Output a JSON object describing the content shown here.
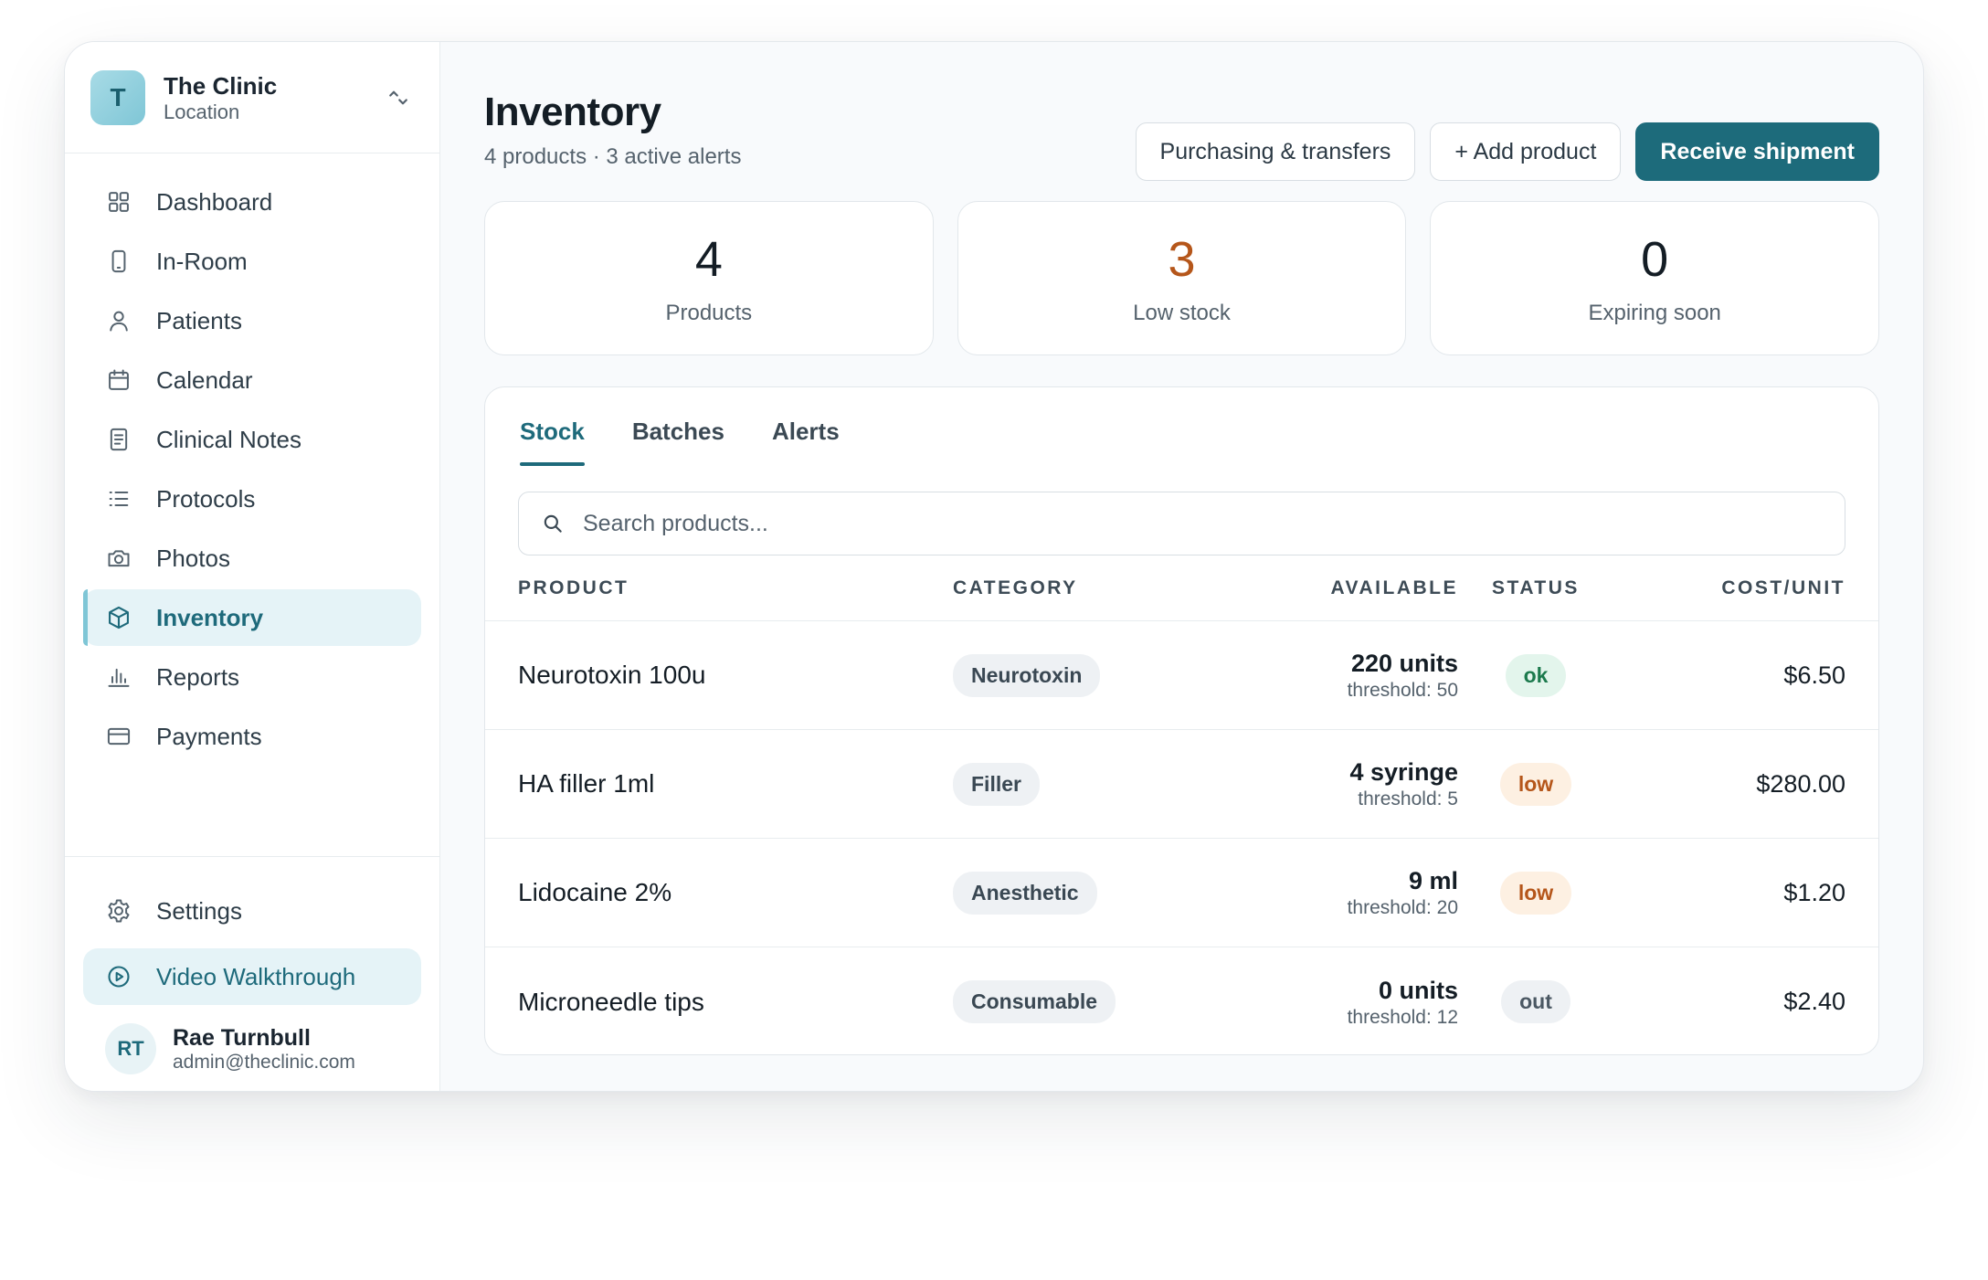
{
  "clinic": {
    "initial": "T",
    "name": "The Clinic",
    "subtitle": "Location"
  },
  "nav": {
    "items": [
      {
        "label": "Dashboard",
        "icon": "grid-icon"
      },
      {
        "label": "In-Room",
        "icon": "phone-icon"
      },
      {
        "label": "Patients",
        "icon": "user-icon"
      },
      {
        "label": "Calendar",
        "icon": "calendar-icon"
      },
      {
        "label": "Clinical Notes",
        "icon": "document-icon"
      },
      {
        "label": "Protocols",
        "icon": "list-icon"
      },
      {
        "label": "Photos",
        "icon": "camera-icon"
      },
      {
        "label": "Inventory",
        "icon": "box-icon",
        "active": true
      },
      {
        "label": "Reports",
        "icon": "bar-chart-icon"
      },
      {
        "label": "Payments",
        "icon": "credit-card-icon"
      }
    ]
  },
  "bottom": {
    "settings_label": "Settings",
    "video_label": "Video Walkthrough"
  },
  "user": {
    "initials": "RT",
    "name": "Rae Turnbull",
    "email": "admin@theclinic.com"
  },
  "header": {
    "title": "Inventory",
    "subtitle": "4 products · 3 active alerts",
    "purchasing_label": "Purchasing & transfers",
    "add_label": "+ Add product",
    "receive_label": "Receive shipment"
  },
  "stats": [
    {
      "value": "4",
      "label": "Products"
    },
    {
      "value": "3",
      "label": "Low stock",
      "color": "#b5561a"
    },
    {
      "value": "0",
      "label": "Expiring soon"
    }
  ],
  "tabs": [
    {
      "label": "Stock",
      "active": true
    },
    {
      "label": "Batches"
    },
    {
      "label": "Alerts"
    }
  ],
  "search": {
    "placeholder": "Search products...",
    "value": ""
  },
  "table": {
    "columns": [
      "PRODUCT",
      "CATEGORY",
      "AVAILABLE",
      "STATUS",
      "COST/UNIT"
    ],
    "rows": [
      {
        "product": "Neurotoxin 100u",
        "category": "Neurotoxin",
        "available": "220 units",
        "threshold": "threshold: 50",
        "status": "ok",
        "cost": "$6.50"
      },
      {
        "product": "HA filler 1ml",
        "category": "Filler",
        "available": "4 syringe",
        "threshold": "threshold: 5",
        "status": "low",
        "cost": "$280.00"
      },
      {
        "product": "Lidocaine 2%",
        "category": "Anesthetic",
        "available": "9 ml",
        "threshold": "threshold: 20",
        "status": "low",
        "cost": "$1.20"
      },
      {
        "product": "Microneedle tips",
        "category": "Consumable",
        "available": "0 units",
        "threshold": "threshold: 12",
        "status": "out",
        "cost": "$2.40"
      }
    ]
  },
  "colors": {
    "accent": "#1d6b7b",
    "active_bg": "#e5f3f7",
    "warn": "#b5561a",
    "ok": "#1c7a4d"
  }
}
